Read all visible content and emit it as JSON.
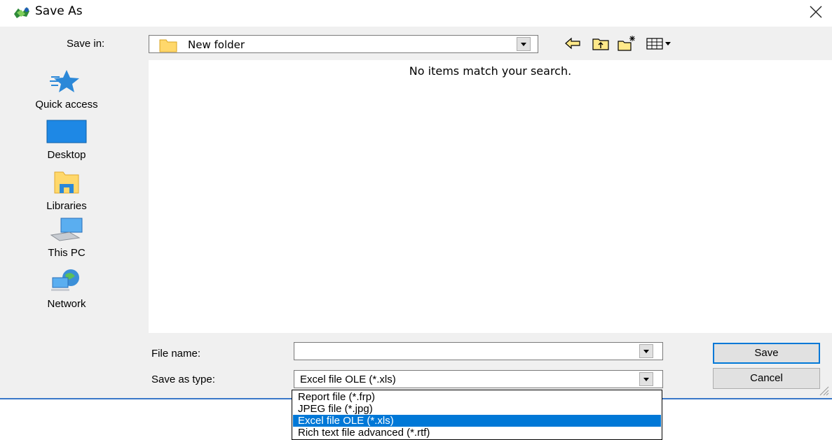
{
  "window": {
    "title": "Save As"
  },
  "save_in": {
    "label": "Save in:",
    "value": "New folder"
  },
  "places": [
    {
      "label": "Quick access",
      "icon": "star-icon"
    },
    {
      "label": "Desktop",
      "icon": "desktop-icon"
    },
    {
      "label": "Libraries",
      "icon": "libraries-icon"
    },
    {
      "label": "This PC",
      "icon": "computer-icon"
    },
    {
      "label": "Network",
      "icon": "network-icon"
    }
  ],
  "file_list": {
    "empty_message": "No items match your search."
  },
  "file_name": {
    "label": "File name:",
    "value": ""
  },
  "save_as_type": {
    "label": "Save as type:",
    "value": "Excel file OLE (*.xls)",
    "options": [
      "Report file (*.frp)",
      "JPEG file (*.jpg)",
      "Excel file OLE (*.xls)",
      "Rich text file advanced (*.rtf)"
    ],
    "selected_index": 2
  },
  "buttons": {
    "save": "Save",
    "cancel": "Cancel"
  },
  "colors": {
    "accent": "#0078d7",
    "dialog_bg": "#f0f0f0",
    "folder": "#ffd86b"
  }
}
